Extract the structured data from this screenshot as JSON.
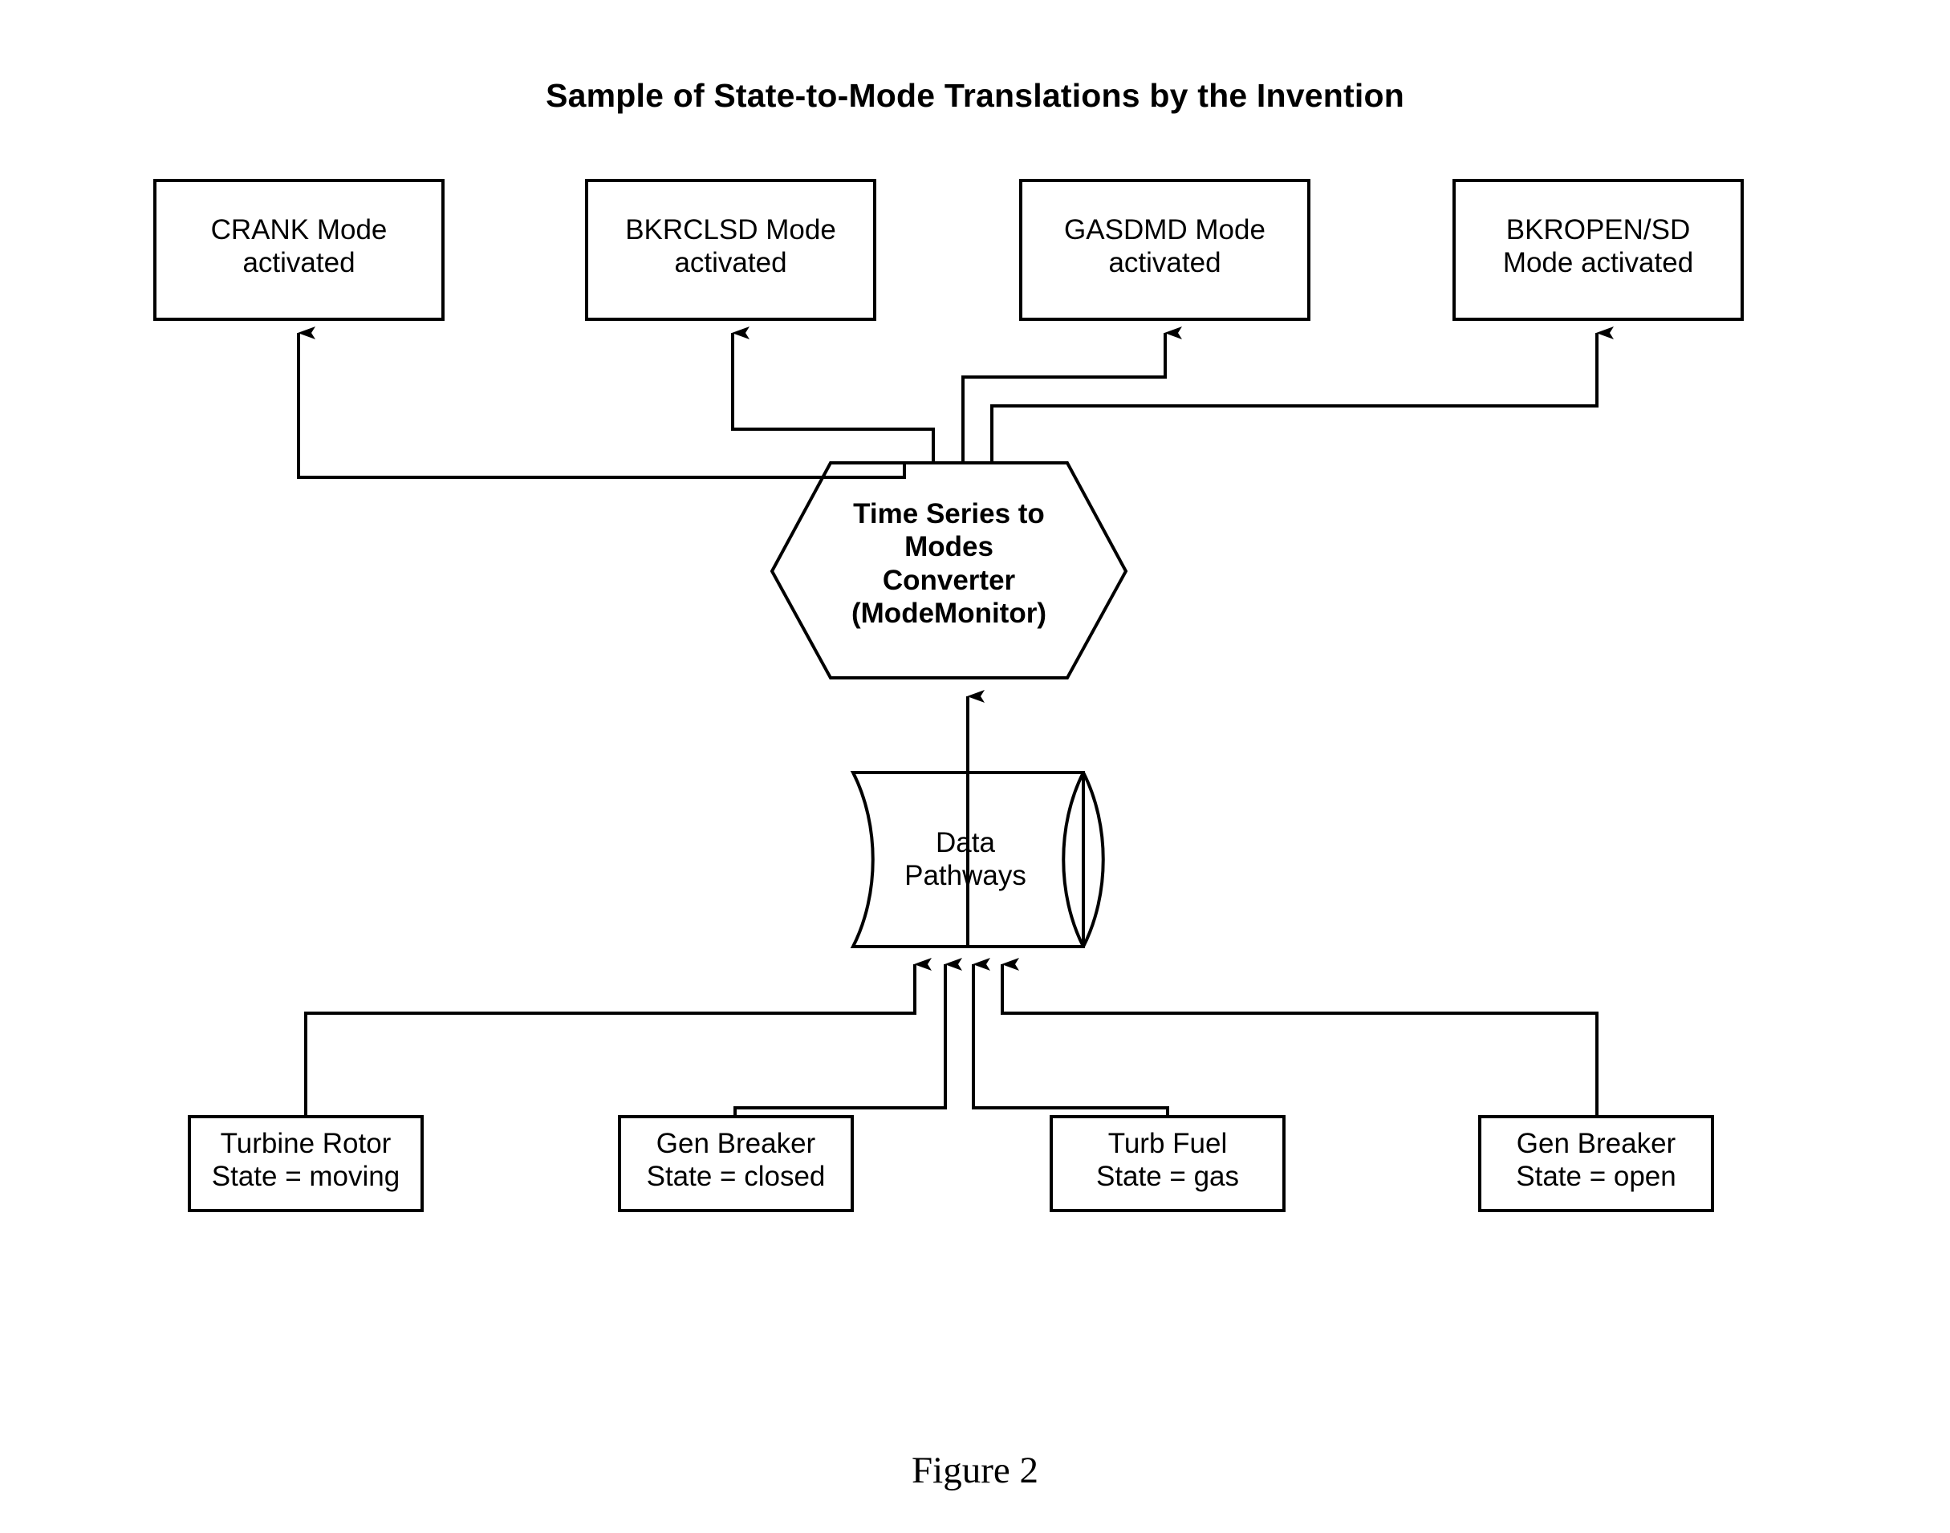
{
  "figure": {
    "title": "Sample of State-to-Mode Translations by the Invention",
    "caption": "Figure 2"
  },
  "colors": {
    "stroke": "#000000",
    "fill": "#ffffff",
    "text": "#000000"
  },
  "mode_boxes": [
    {
      "id": "crank",
      "line1": "CRANK Mode",
      "line2": "activated",
      "text": "CRANK Mode\nactivated"
    },
    {
      "id": "bkrclsd",
      "line1": "BKRCLSD Mode",
      "line2": "activated",
      "text": "BKRCLSD Mode\nactivated"
    },
    {
      "id": "gasdmd",
      "line1": "GASDMD Mode",
      "line2": "activated",
      "text": "GASDMD Mode\nactivated"
    },
    {
      "id": "bkropensd",
      "line1": "BKROPEN/SD",
      "line2": "Mode activated",
      "text": "BKROPEN/SD\nMode activated"
    }
  ],
  "converter": {
    "shape": "hexagon",
    "text": "Time Series to\nModes\nConverter\n(ModeMonitor)",
    "lines": [
      "Time Series to",
      "Modes",
      "Converter",
      "(ModeMonitor)"
    ]
  },
  "datastore": {
    "shape": "cylinder",
    "text": "Data\nPathways",
    "lines": [
      "Data",
      "Pathways"
    ]
  },
  "state_boxes": [
    {
      "id": "turbine-rotor",
      "line1": "Turbine Rotor",
      "line2": "State = moving",
      "text": "Turbine Rotor\nState = moving"
    },
    {
      "id": "gen-breaker-closed",
      "line1": "Gen Breaker",
      "line2": "State = closed",
      "text": "Gen Breaker\nState = closed"
    },
    {
      "id": "turb-fuel-gas",
      "line1": "Turb Fuel",
      "line2": "State = gas",
      "text": "Turb Fuel\nState = gas"
    },
    {
      "id": "gen-breaker-open",
      "line1": "Gen Breaker",
      "line2": "State = open",
      "text": "Gen Breaker\nState = open"
    }
  ],
  "chart_data": {
    "type": "diagram",
    "title": "Sample of State-to-Mode Translations by the Invention",
    "nodes": [
      {
        "id": "crank",
        "label": "CRANK Mode activated",
        "shape": "rectangle",
        "layer": "output"
      },
      {
        "id": "bkrclsd",
        "label": "BKRCLSD Mode activated",
        "shape": "rectangle",
        "layer": "output"
      },
      {
        "id": "gasdmd",
        "label": "GASDMD Mode activated",
        "shape": "rectangle",
        "layer": "output"
      },
      {
        "id": "bkropensd",
        "label": "BKROPEN/SD Mode activated",
        "shape": "rectangle",
        "layer": "output"
      },
      {
        "id": "converter",
        "label": "Time Series to Modes Converter (ModeMonitor)",
        "shape": "hexagon",
        "layer": "process"
      },
      {
        "id": "datastore",
        "label": "Data Pathways",
        "shape": "cylinder",
        "layer": "storage"
      },
      {
        "id": "turbine-rotor",
        "label": "Turbine Rotor State = moving",
        "shape": "rectangle",
        "layer": "input"
      },
      {
        "id": "gen-breaker-closed",
        "label": "Gen Breaker State = closed",
        "shape": "rectangle",
        "layer": "input"
      },
      {
        "id": "turb-fuel-gas",
        "label": "Turb Fuel State = gas",
        "shape": "rectangle",
        "layer": "input"
      },
      {
        "id": "gen-breaker-open",
        "label": "Gen Breaker State = open",
        "shape": "rectangle",
        "layer": "input"
      }
    ],
    "edges": [
      {
        "from": "turbine-rotor",
        "to": "datastore",
        "arrow": true
      },
      {
        "from": "gen-breaker-closed",
        "to": "datastore",
        "arrow": true
      },
      {
        "from": "turb-fuel-gas",
        "to": "datastore",
        "arrow": true
      },
      {
        "from": "gen-breaker-open",
        "to": "datastore",
        "arrow": true
      },
      {
        "from": "datastore",
        "to": "converter",
        "arrow": true
      },
      {
        "from": "converter",
        "to": "crank",
        "arrow": true
      },
      {
        "from": "converter",
        "to": "bkrclsd",
        "arrow": true
      },
      {
        "from": "converter",
        "to": "gasdmd",
        "arrow": true
      },
      {
        "from": "converter",
        "to": "bkropensd",
        "arrow": true
      }
    ]
  }
}
